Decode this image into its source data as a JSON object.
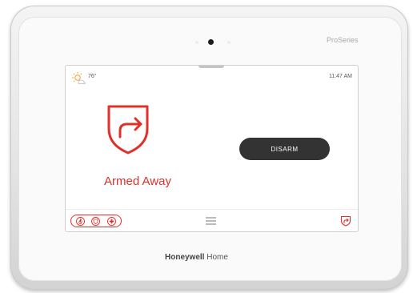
{
  "device": {
    "model_label": "ProSeries",
    "brand_bold": "Honeywell",
    "brand_light": " Home"
  },
  "screen": {
    "temperature": "76°",
    "time": "11:47 AM",
    "status_label": "Armed Away",
    "disarm_label": "DISARM",
    "accent_color": "#e0302a"
  },
  "icons": {
    "weather": "sun-cloud-icon",
    "status": "shield-arrow-icon",
    "sensors": [
      "fire-icon",
      "security-icon",
      "medical-icon"
    ],
    "menu": "hamburger-menu-icon",
    "quick_arm": "shield-arrow-icon"
  }
}
